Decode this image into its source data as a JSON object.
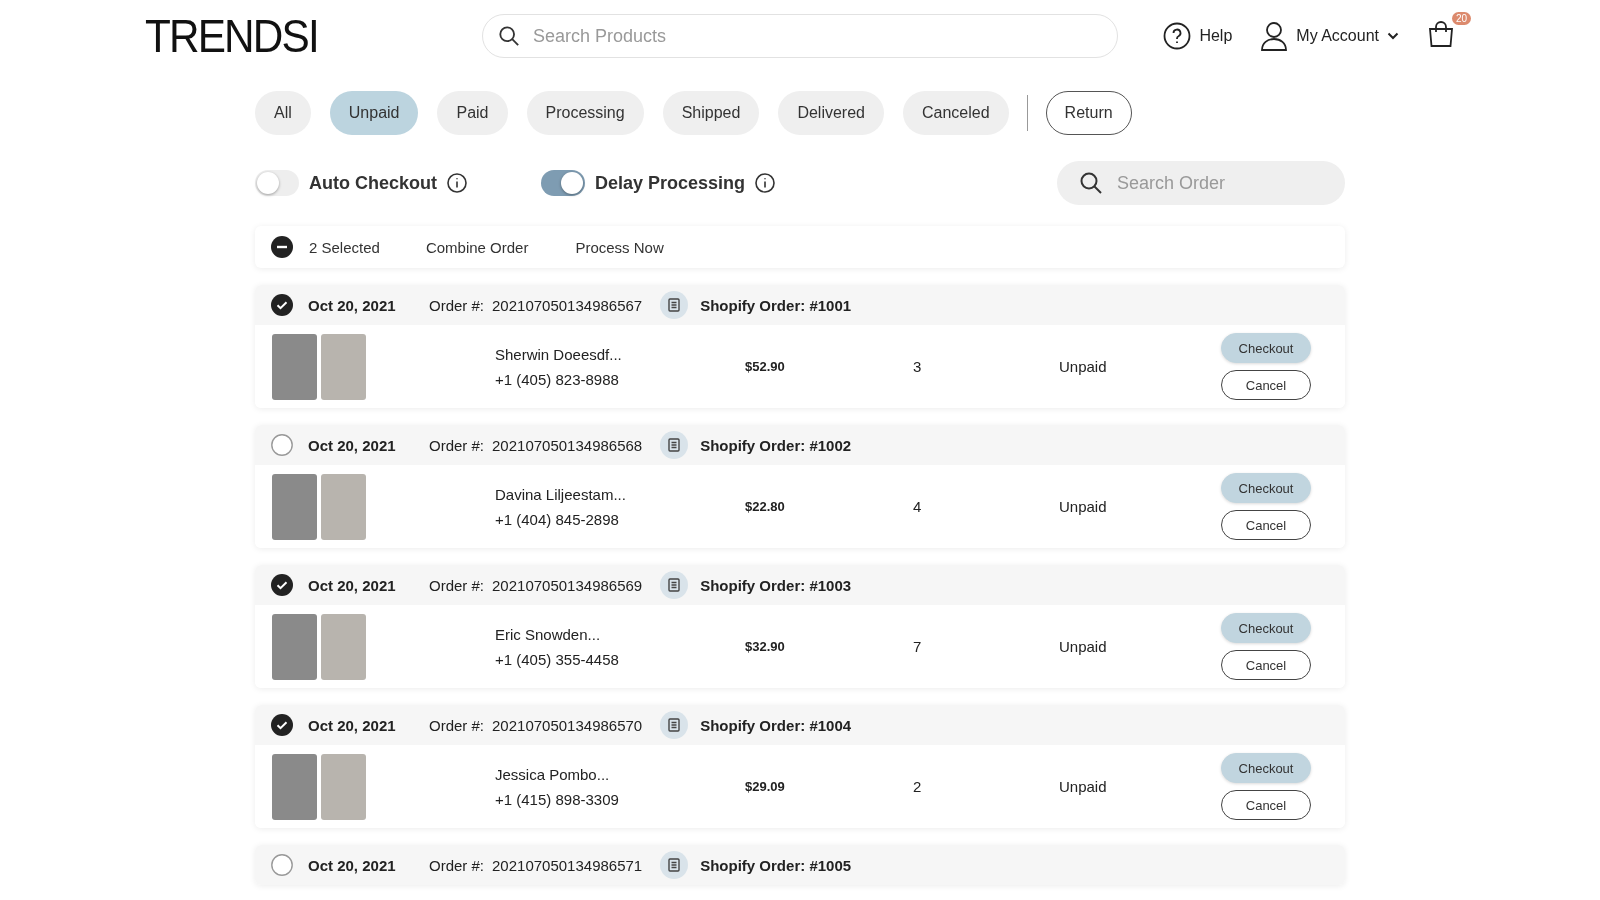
{
  "header": {
    "logo": "TRENDSI",
    "search": {
      "placeholder": "Search Products"
    },
    "help": "Help",
    "account": "My Account",
    "cart_count": "20"
  },
  "tabs": [
    {
      "label": "All",
      "selected": false,
      "kind": "filled"
    },
    {
      "label": "Unpaid",
      "selected": true,
      "kind": "filled"
    },
    {
      "label": "Paid",
      "selected": false,
      "kind": "filled"
    },
    {
      "label": "Processing",
      "selected": false,
      "kind": "filled"
    },
    {
      "label": "Shipped",
      "selected": false,
      "kind": "filled"
    },
    {
      "label": "Delivered",
      "selected": false,
      "kind": "filled"
    },
    {
      "label": "Canceled",
      "selected": false,
      "kind": "filled"
    },
    {
      "label": "Return",
      "selected": false,
      "kind": "outline"
    }
  ],
  "toggles": [
    {
      "label": "Auto Checkout",
      "on": false
    },
    {
      "label": "Delay Processing",
      "on": true
    }
  ],
  "order_search": {
    "placeholder": "Search Order"
  },
  "bulk_bar": {
    "selected_count": "2 Selected",
    "actions": [
      "Combine Order",
      "Process Now"
    ]
  },
  "orders": [
    {
      "checked": true,
      "date": "Oct 20, 2021",
      "order_label": "Order #:",
      "order_number": "202107050134986567",
      "shopify": "Shopify Order: #1001",
      "customer": "Sherwin Doeesdf...",
      "phone": "+1 (405) 823-8988",
      "price": "$52.90",
      "qty": "3",
      "status": "Unpaid",
      "buttons": [
        "Checkout",
        "Cancel"
      ]
    },
    {
      "checked": false,
      "date": "Oct 20, 2021",
      "order_label": "Order #:",
      "order_number": "202107050134986568",
      "shopify": "Shopify Order: #1002",
      "customer": "Davina Liljeestam...",
      "phone": "+1 (404) 845-2898",
      "price": "$22.80",
      "qty": "4",
      "status": "Unpaid",
      "buttons": [
        "Checkout",
        "Cancel"
      ]
    },
    {
      "checked": true,
      "date": "Oct 20, 2021",
      "order_label": "Order #:",
      "order_number": "202107050134986569",
      "shopify": "Shopify Order: #1003",
      "customer": "Eric Snowden...",
      "phone": "+1 (405) 355-4458",
      "price": "$32.90",
      "qty": "7",
      "status": "Unpaid",
      "buttons": [
        "Checkout",
        "Cancel"
      ]
    },
    {
      "checked": true,
      "date": "Oct 20, 2021",
      "order_label": "Order #:",
      "order_number": "202107050134986570",
      "shopify": "Shopify Order: #1004",
      "customer": "Jessica Pombo...",
      "phone": "+1 (415) 898-3309",
      "price": "$29.09",
      "qty": "2",
      "status": "Unpaid",
      "buttons": [
        "Checkout",
        "Cancel"
      ]
    },
    {
      "checked": false,
      "date": "Oct 20, 2021",
      "order_label": "Order #:",
      "order_number": "202107050134986571",
      "shopify": "Shopify Order: #1005"
    }
  ]
}
